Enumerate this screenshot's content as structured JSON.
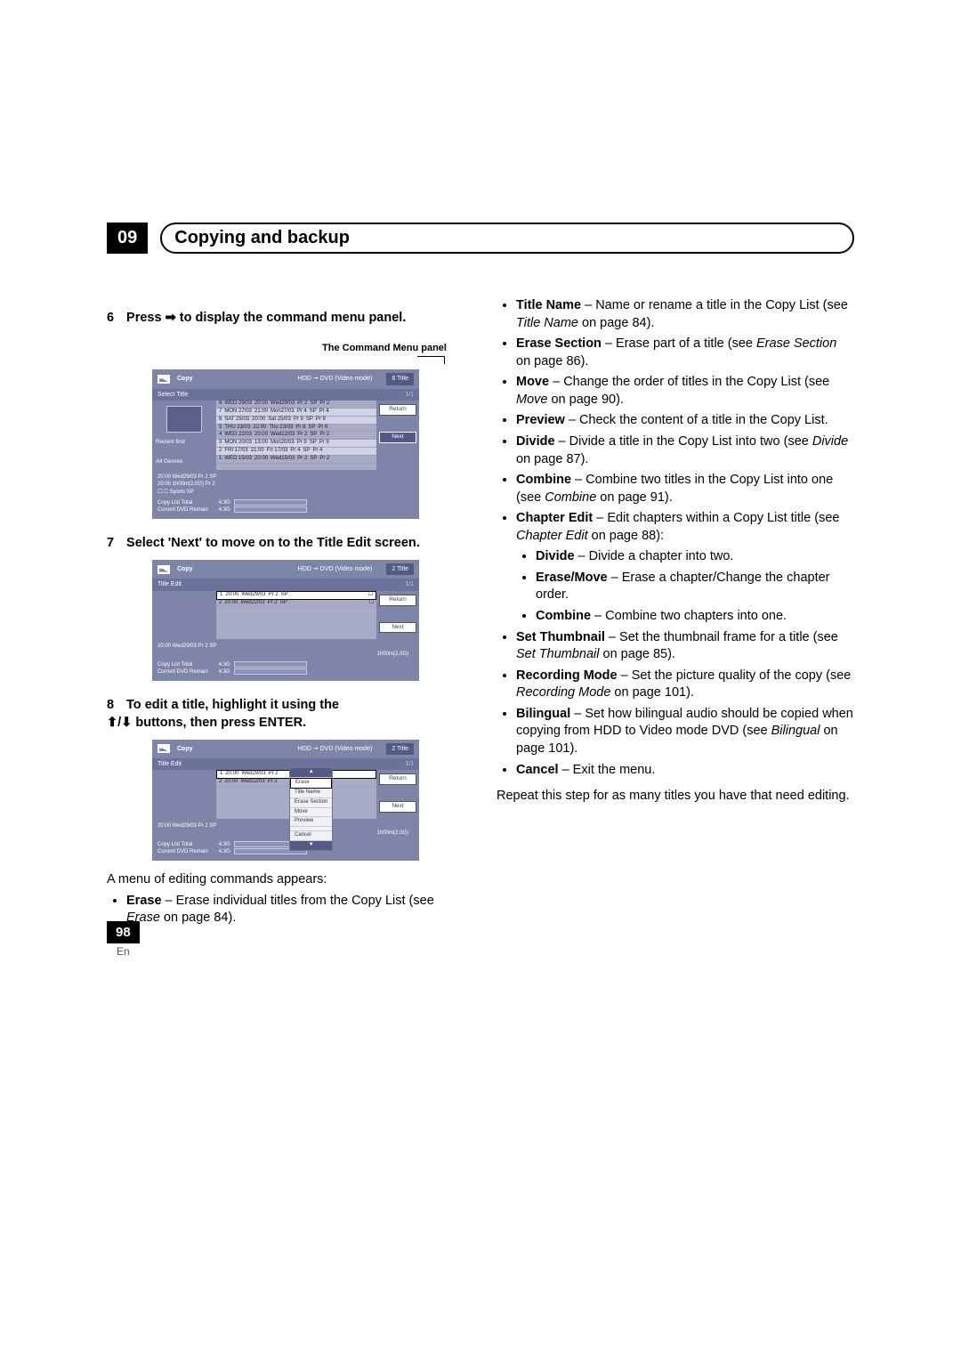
{
  "chapter": {
    "number": "09",
    "title": "Copying and backup"
  },
  "steps": {
    "s6": {
      "num": "6",
      "text": "Press ➡ to display the command menu panel."
    },
    "s7": {
      "num": "7",
      "text": "Select 'Next' to move on to the Title Edit screen."
    },
    "s8": {
      "num": "8",
      "line1": "To edit a title, highlight it using the",
      "line2": "⬆/⬇ buttons, then press ENTER."
    }
  },
  "label_command_panel": "The Command Menu panel",
  "screenshot_common": {
    "copy": "Copy",
    "mode": "HDD ➞ DVD (Video mode)",
    "return": "Return",
    "next": "Next",
    "copy_list_total": "Copy List Total",
    "current_dvd_remain": "Current DVD Remain",
    "v43g": "4.3G"
  },
  "ss1": {
    "title_count": "8  Title",
    "left_header": "Select Title",
    "nav1": "Recent first",
    "nav2": "All Genres",
    "rows": [
      [
        "8",
        "WED 29/03",
        "20:00",
        "Wed29/03",
        "Pr 2",
        "SP",
        "Pr 2"
      ],
      [
        "7",
        "MON 27/03",
        "21:00",
        "Mon27/03",
        "Pr 4",
        "SP",
        "Pr 4"
      ],
      [
        "6",
        "SAT 25/03",
        "20:00",
        "Sat 25/03",
        "Pr 9",
        "SP",
        "Pr 9"
      ],
      [
        "5",
        "THU 23/03",
        "22:00",
        "Thu 23/03",
        "Pr 6",
        "SP",
        "Pr 6"
      ],
      [
        "4",
        "WED 22/03",
        "20:00",
        "Wed22/03",
        "Pr 2",
        "SP",
        "Pr 2"
      ],
      [
        "3",
        "MON 20/03",
        "13:00",
        "Mon20/03",
        "Pr 9",
        "SP",
        "Pr 9"
      ],
      [
        "2",
        "FRI  17/03",
        "21:00",
        "Fri  17/03",
        "Pr 4",
        "SP",
        "Pr 4"
      ],
      [
        "1",
        "WED 15/03",
        "20:00",
        "Wed15/03",
        "Pr 2",
        "SP",
        "Pr 2"
      ]
    ],
    "detail": {
      "l1": "20:00   Wed29/03  Pr 2  SP",
      "l2": "20:00          1h00m(2.0G)               Pr 2",
      "l3": "🖵          ☐ Sports       SP"
    }
  },
  "ss2": {
    "title_count": "2  Title",
    "left_header": "Title Edit",
    "rows": [
      [
        "1",
        "20:00",
        "Wed29/03",
        "Pr 2",
        "SP"
      ],
      [
        "2",
        "20:00",
        "Wed22/03",
        "Pr 2",
        "SP"
      ]
    ],
    "detail": {
      "l1": "20:00   Wed29/03  Pr 2  SP",
      "l2": "1h00m(2.0G)"
    }
  },
  "ss3": {
    "title_count": "2  Title",
    "left_header": "Title Edit",
    "rows": [
      [
        "1",
        "20:00",
        "Wed29/03",
        "Pr 2"
      ],
      [
        "2",
        "20:00",
        "Wed22/03",
        "Pr 2"
      ]
    ],
    "menu": [
      "Erase",
      "Title Name",
      "Erase Section",
      "Move",
      "Preview",
      "",
      "Cancel"
    ],
    "detail": {
      "l1": "20:00   Wed29/03  Pr 2  SP",
      "l2": "1h00m(2.0G)"
    }
  },
  "after_ss3": {
    "intro": "A menu of editing commands appears:",
    "erase": {
      "b": "Erase",
      "t": " – Erase individual titles from the Copy List (see ",
      "i": "Erase",
      "t2": " on page 84)."
    }
  },
  "right_items": {
    "title_name": {
      "b": "Title Name",
      "t": " – Name or rename a title in the Copy List (see ",
      "i": "Title Name",
      "t2": " on page 84)."
    },
    "erase_section": {
      "b": "Erase Section",
      "t": " – Erase part of a title (see ",
      "i": "Erase Section",
      "t2": " on page 86)."
    },
    "move": {
      "b": "Move",
      "t": " – Change the order of titles in the Copy List (see ",
      "i": "Move",
      "t2": " on page 90)."
    },
    "preview": {
      "b": "Preview",
      "t": " – Check the content of a title in the Copy List."
    },
    "divide": {
      "b": "Divide",
      "t": " – Divide a title in the Copy List into two (see ",
      "i": "Divide",
      "t2": " on page 87)."
    },
    "combine": {
      "b": "Combine",
      "t": " – Combine two titles in the Copy List into one (see ",
      "i": "Combine",
      "t2": " on page 91)."
    },
    "chapter_edit": {
      "b": "Chapter Edit",
      "t": " – Edit chapters within a Copy List title (see ",
      "i": "Chapter Edit",
      "t2": " on page 88):"
    },
    "set_thumb": {
      "b": "Set Thumbnail",
      "t": " – Set the thumbnail frame for a title (see ",
      "i": "Set Thumbnail",
      "t2": " on page 85)."
    },
    "rec_mode": {
      "b": "Recording Mode",
      "t": " – Set the picture quality of the copy (see ",
      "i": "Recording Mode",
      "t2": " on page 101)."
    },
    "bilingual": {
      "b": "Bilingual",
      "t": " – Set how bilingual audio should be copied when copying from HDD to Video mode DVD (see ",
      "i": "Bilingual",
      "t2": " on page 101)."
    },
    "cancel": {
      "b": "Cancel",
      "t": " – Exit the menu."
    }
  },
  "sub_items": {
    "divide": {
      "b": "Divide",
      "t": " – Divide a chapter into two."
    },
    "erase_move": {
      "b": "Erase/Move",
      "t": " – Erase a chapter/Change the chapter order."
    },
    "combine": {
      "b": "Combine",
      "t": " – Combine two chapters into one."
    }
  },
  "closing": "Repeat this step for as many titles you have that need editing.",
  "page": {
    "num": "98",
    "lang": "En"
  }
}
